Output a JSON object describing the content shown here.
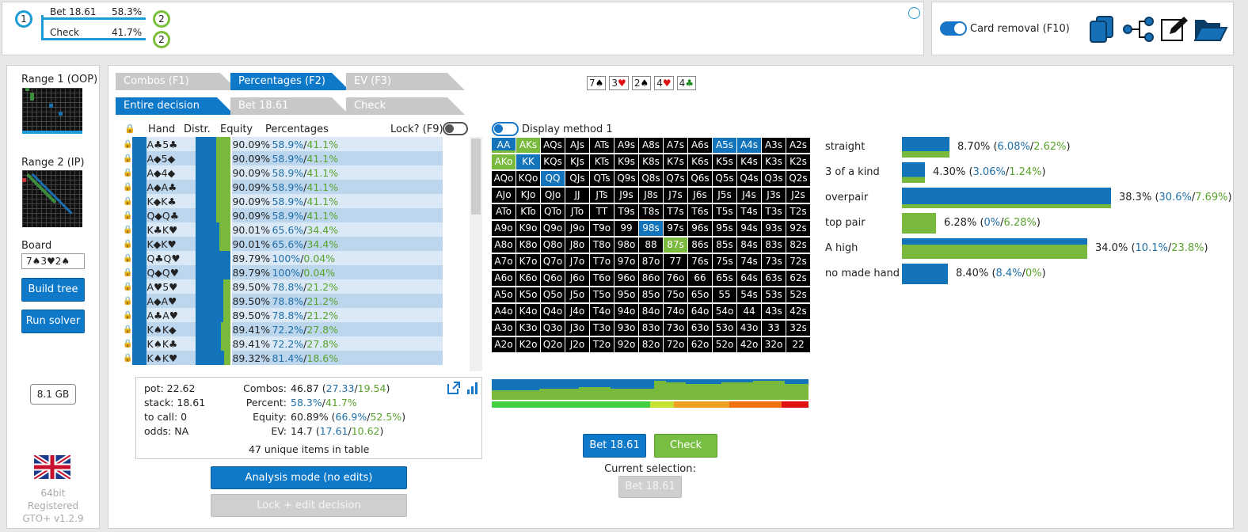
{
  "tree": {
    "root": "1",
    "child_node": "2",
    "actions": [
      {
        "label": "Bet 18.61",
        "pct": "58.3%"
      },
      {
        "label": "Check",
        "pct": "41.7%"
      }
    ]
  },
  "topright": {
    "card_removal": "Card removal (F10)",
    "icons": [
      "copy-icon",
      "tree-icon",
      "edit-icon",
      "folder-icon"
    ]
  },
  "left": {
    "range1": "Range 1 (OOP)",
    "range2": "Range 2 (IP)",
    "board_label": "Board",
    "board_value": "7♠3♥2♠",
    "build": "Build tree",
    "run": "Run solver",
    "mem": "8.1 GB",
    "version": [
      "64bit",
      "Registered",
      "GTO+ v1.2.9"
    ]
  },
  "tabs": {
    "row1": [
      "Combos (F1)",
      "Percentages (F2)",
      "EV (F3)"
    ],
    "row2": [
      "Entire decision",
      "Bet 18.61",
      "Check"
    ]
  },
  "board_cards": [
    {
      "r": "7",
      "s": "♠",
      "c": "#000"
    },
    {
      "r": "3",
      "s": "♥",
      "c": "#d11"
    },
    {
      "r": "2",
      "s": "♠",
      "c": "#000"
    },
    {
      "r": "4",
      "s": "♥",
      "c": "#d11"
    },
    {
      "r": "4",
      "s": "♣",
      "c": "#1a8a1a"
    }
  ],
  "table": {
    "headers": [
      "Hand",
      "Distr.",
      "Equity",
      "Percentages"
    ],
    "lock": "Lock? (F9)",
    "rows": [
      {
        "h": "A♣5♣",
        "eq": "90.09%",
        "b": "58.9%",
        "c": "41.1%"
      },
      {
        "h": "A◆5◆",
        "eq": "90.09%",
        "b": "58.9%",
        "c": "41.1%"
      },
      {
        "h": "A◆4◆",
        "eq": "90.09%",
        "b": "58.9%",
        "c": "41.1%"
      },
      {
        "h": "A◆A♣",
        "eq": "90.09%",
        "b": "58.9%",
        "c": "41.1%"
      },
      {
        "h": "K◆K♣",
        "eq": "90.09%",
        "b": "58.9%",
        "c": "41.1%"
      },
      {
        "h": "Q◆Q♣",
        "eq": "90.09%",
        "b": "58.9%",
        "c": "41.1%"
      },
      {
        "h": "K♣K♥",
        "eq": "90.01%",
        "b": "65.6%",
        "c": "34.4%"
      },
      {
        "h": "K◆K♥",
        "eq": "90.01%",
        "b": "65.6%",
        "c": "34.4%"
      },
      {
        "h": "Q♣Q♥",
        "eq": "89.79%",
        "b": "100%",
        "c": "0.04%"
      },
      {
        "h": "Q◆Q♥",
        "eq": "89.79%",
        "b": "100%",
        "c": "0.04%"
      },
      {
        "h": "A♥5♥",
        "eq": "89.50%",
        "b": "78.8%",
        "c": "21.2%"
      },
      {
        "h": "A◆A♥",
        "eq": "89.50%",
        "b": "78.8%",
        "c": "21.2%"
      },
      {
        "h": "A♣A♥",
        "eq": "89.50%",
        "b": "78.8%",
        "c": "21.2%"
      },
      {
        "h": "K♠K◆",
        "eq": "89.41%",
        "b": "72.2%",
        "c": "27.8%"
      },
      {
        "h": "K♠K♣",
        "eq": "89.41%",
        "b": "72.2%",
        "c": "27.8%"
      },
      {
        "h": "K♠K♥",
        "eq": "89.32%",
        "b": "81.4%",
        "c": "18.6%"
      }
    ]
  },
  "summary": {
    "pot": "pot: 22.62",
    "stack": "stack: 18.61",
    "tocall": "to call: 0",
    "odds": "odds: NA",
    "combos_l": "Combos:",
    "combos": "46.87",
    "combos_b": "27.33",
    "combos_c": "19.54",
    "percent_l": "Percent:",
    "percent_b": "58.3%",
    "percent_c": "41.7%",
    "equity_l": "Equity:",
    "equity": "60.89%",
    "equity_b": "66.9%",
    "equity_c": "52.5%",
    "ev_l": "EV:",
    "ev": "14.7",
    "ev_b": "17.61",
    "ev_c": "10.62",
    "unique": "47 unique items in table"
  },
  "modes": {
    "analysis": "Analysis mode (no edits)",
    "lock_edit": "Lock + edit decision"
  },
  "display_method": "Display method 1",
  "grid_rows": [
    [
      "AA",
      "AKs",
      "AQs",
      "AJs",
      "ATs",
      "A9s",
      "A8s",
      "A7s",
      "A6s",
      "A5s",
      "A4s",
      "A3s",
      "A2s"
    ],
    [
      "AKo",
      "KK",
      "KQs",
      "KJs",
      "KTs",
      "K9s",
      "K8s",
      "K7s",
      "K6s",
      "K5s",
      "K4s",
      "K3s",
      "K2s"
    ],
    [
      "AQo",
      "KQo",
      "QQ",
      "QJs",
      "QTs",
      "Q9s",
      "Q8s",
      "Q7s",
      "Q6s",
      "Q5s",
      "Q4s",
      "Q3s",
      "Q2s"
    ],
    [
      "AJo",
      "KJo",
      "QJo",
      "JJ",
      "JTs",
      "J9s",
      "J8s",
      "J7s",
      "J6s",
      "J5s",
      "J4s",
      "J3s",
      "J2s"
    ],
    [
      "ATo",
      "KTo",
      "QTo",
      "JTo",
      "TT",
      "T9s",
      "T8s",
      "T7s",
      "T6s",
      "T5s",
      "T4s",
      "T3s",
      "T2s"
    ],
    [
      "A9o",
      "K9o",
      "Q9o",
      "J9o",
      "T9o",
      "99",
      "98s",
      "97s",
      "96s",
      "95s",
      "94s",
      "93s",
      "92s"
    ],
    [
      "A8o",
      "K8o",
      "Q8o",
      "J8o",
      "T8o",
      "98o",
      "88",
      "87s",
      "86s",
      "85s",
      "84s",
      "83s",
      "82s"
    ],
    [
      "A7o",
      "K7o",
      "Q7o",
      "J7o",
      "T7o",
      "97o",
      "87o",
      "77",
      "76s",
      "75s",
      "74s",
      "73s",
      "72s"
    ],
    [
      "A6o",
      "K6o",
      "Q6o",
      "J6o",
      "T6o",
      "96o",
      "86o",
      "76o",
      "66",
      "65s",
      "64s",
      "63s",
      "62s"
    ],
    [
      "A5o",
      "K5o",
      "Q5o",
      "J5o",
      "T5o",
      "95o",
      "85o",
      "75o",
      "65o",
      "55",
      "54s",
      "53s",
      "52s"
    ],
    [
      "A4o",
      "K4o",
      "Q4o",
      "J4o",
      "T4o",
      "94o",
      "84o",
      "74o",
      "64o",
      "54o",
      "44",
      "43s",
      "42s"
    ],
    [
      "A3o",
      "K3o",
      "Q3o",
      "J3o",
      "T3o",
      "93o",
      "83o",
      "73o",
      "63o",
      "53o",
      "43o",
      "33",
      "32s"
    ],
    [
      "A2o",
      "K2o",
      "Q2o",
      "J2o",
      "T2o",
      "92o",
      "82o",
      "72o",
      "62o",
      "52o",
      "42o",
      "32o",
      "22"
    ]
  ],
  "actions": {
    "bet": "Bet 18.61",
    "check": "Check",
    "current": "Current selection:",
    "selected": "Bet 18.61"
  },
  "categories": [
    {
      "name": "straight",
      "total": "8.70%",
      "b": "6.08%",
      "c": "2.62%"
    },
    {
      "name": "3 of a kind",
      "total": "4.30%",
      "b": "3.06%",
      "c": "1.24%"
    },
    {
      "name": "overpair",
      "total": "38.3%",
      "b": "30.6%",
      "c": "7.69%"
    },
    {
      "name": "top pair",
      "total": "6.28%",
      "b": "0%",
      "c": "6.28%"
    },
    {
      "name": "A high",
      "total": "34.0%",
      "b": "10.1%",
      "c": "23.8%"
    },
    {
      "name": "no made hand",
      "total": "8.40%",
      "b": "8.4%",
      "c": "0%"
    }
  ],
  "colors": {
    "blue": "#1374bb",
    "green": "#79b93c",
    "ring_blue": "#1e9ad6"
  }
}
